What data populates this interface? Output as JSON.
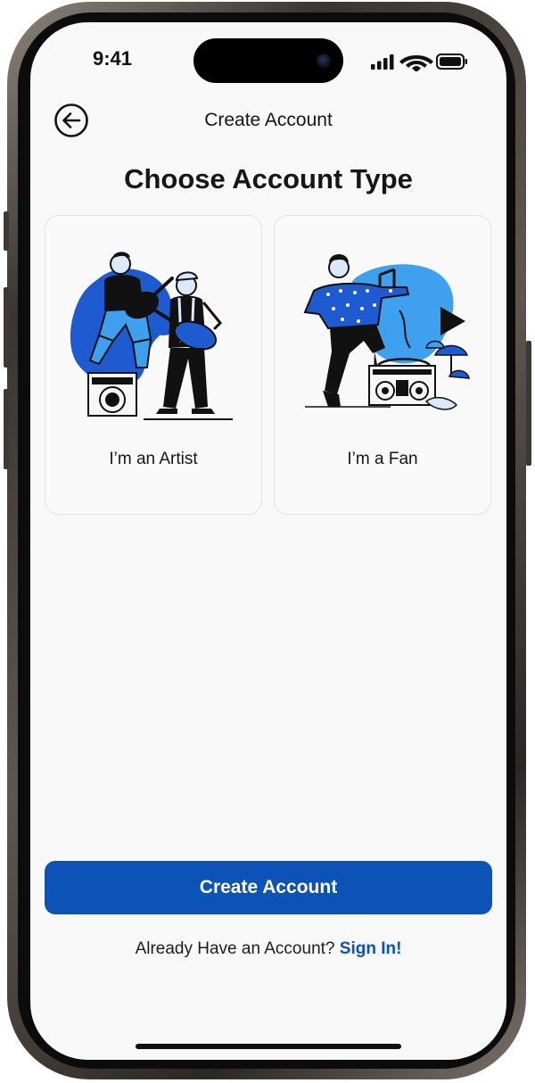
{
  "status_bar": {
    "time": "9:41"
  },
  "header": {
    "title": "Create Account",
    "back_icon": "back-arrow-circle-icon"
  },
  "main": {
    "heading": "Choose Account Type",
    "options": [
      {
        "label": "I’m an Artist",
        "illustration": "guitarists-illustration"
      },
      {
        "label": "I’m a Fan",
        "illustration": "dancing-fan-illustration"
      }
    ]
  },
  "footer": {
    "create_button_label": "Create Account",
    "signin_prompt": "Already Have an Account?",
    "signin_link": "Sign In!"
  },
  "colors": {
    "brand_blue": "#0d52b7",
    "illustration_blue": "#1e5bd0",
    "illustration_light_blue": "#3fa0f0",
    "background": "#f8f8f8"
  }
}
